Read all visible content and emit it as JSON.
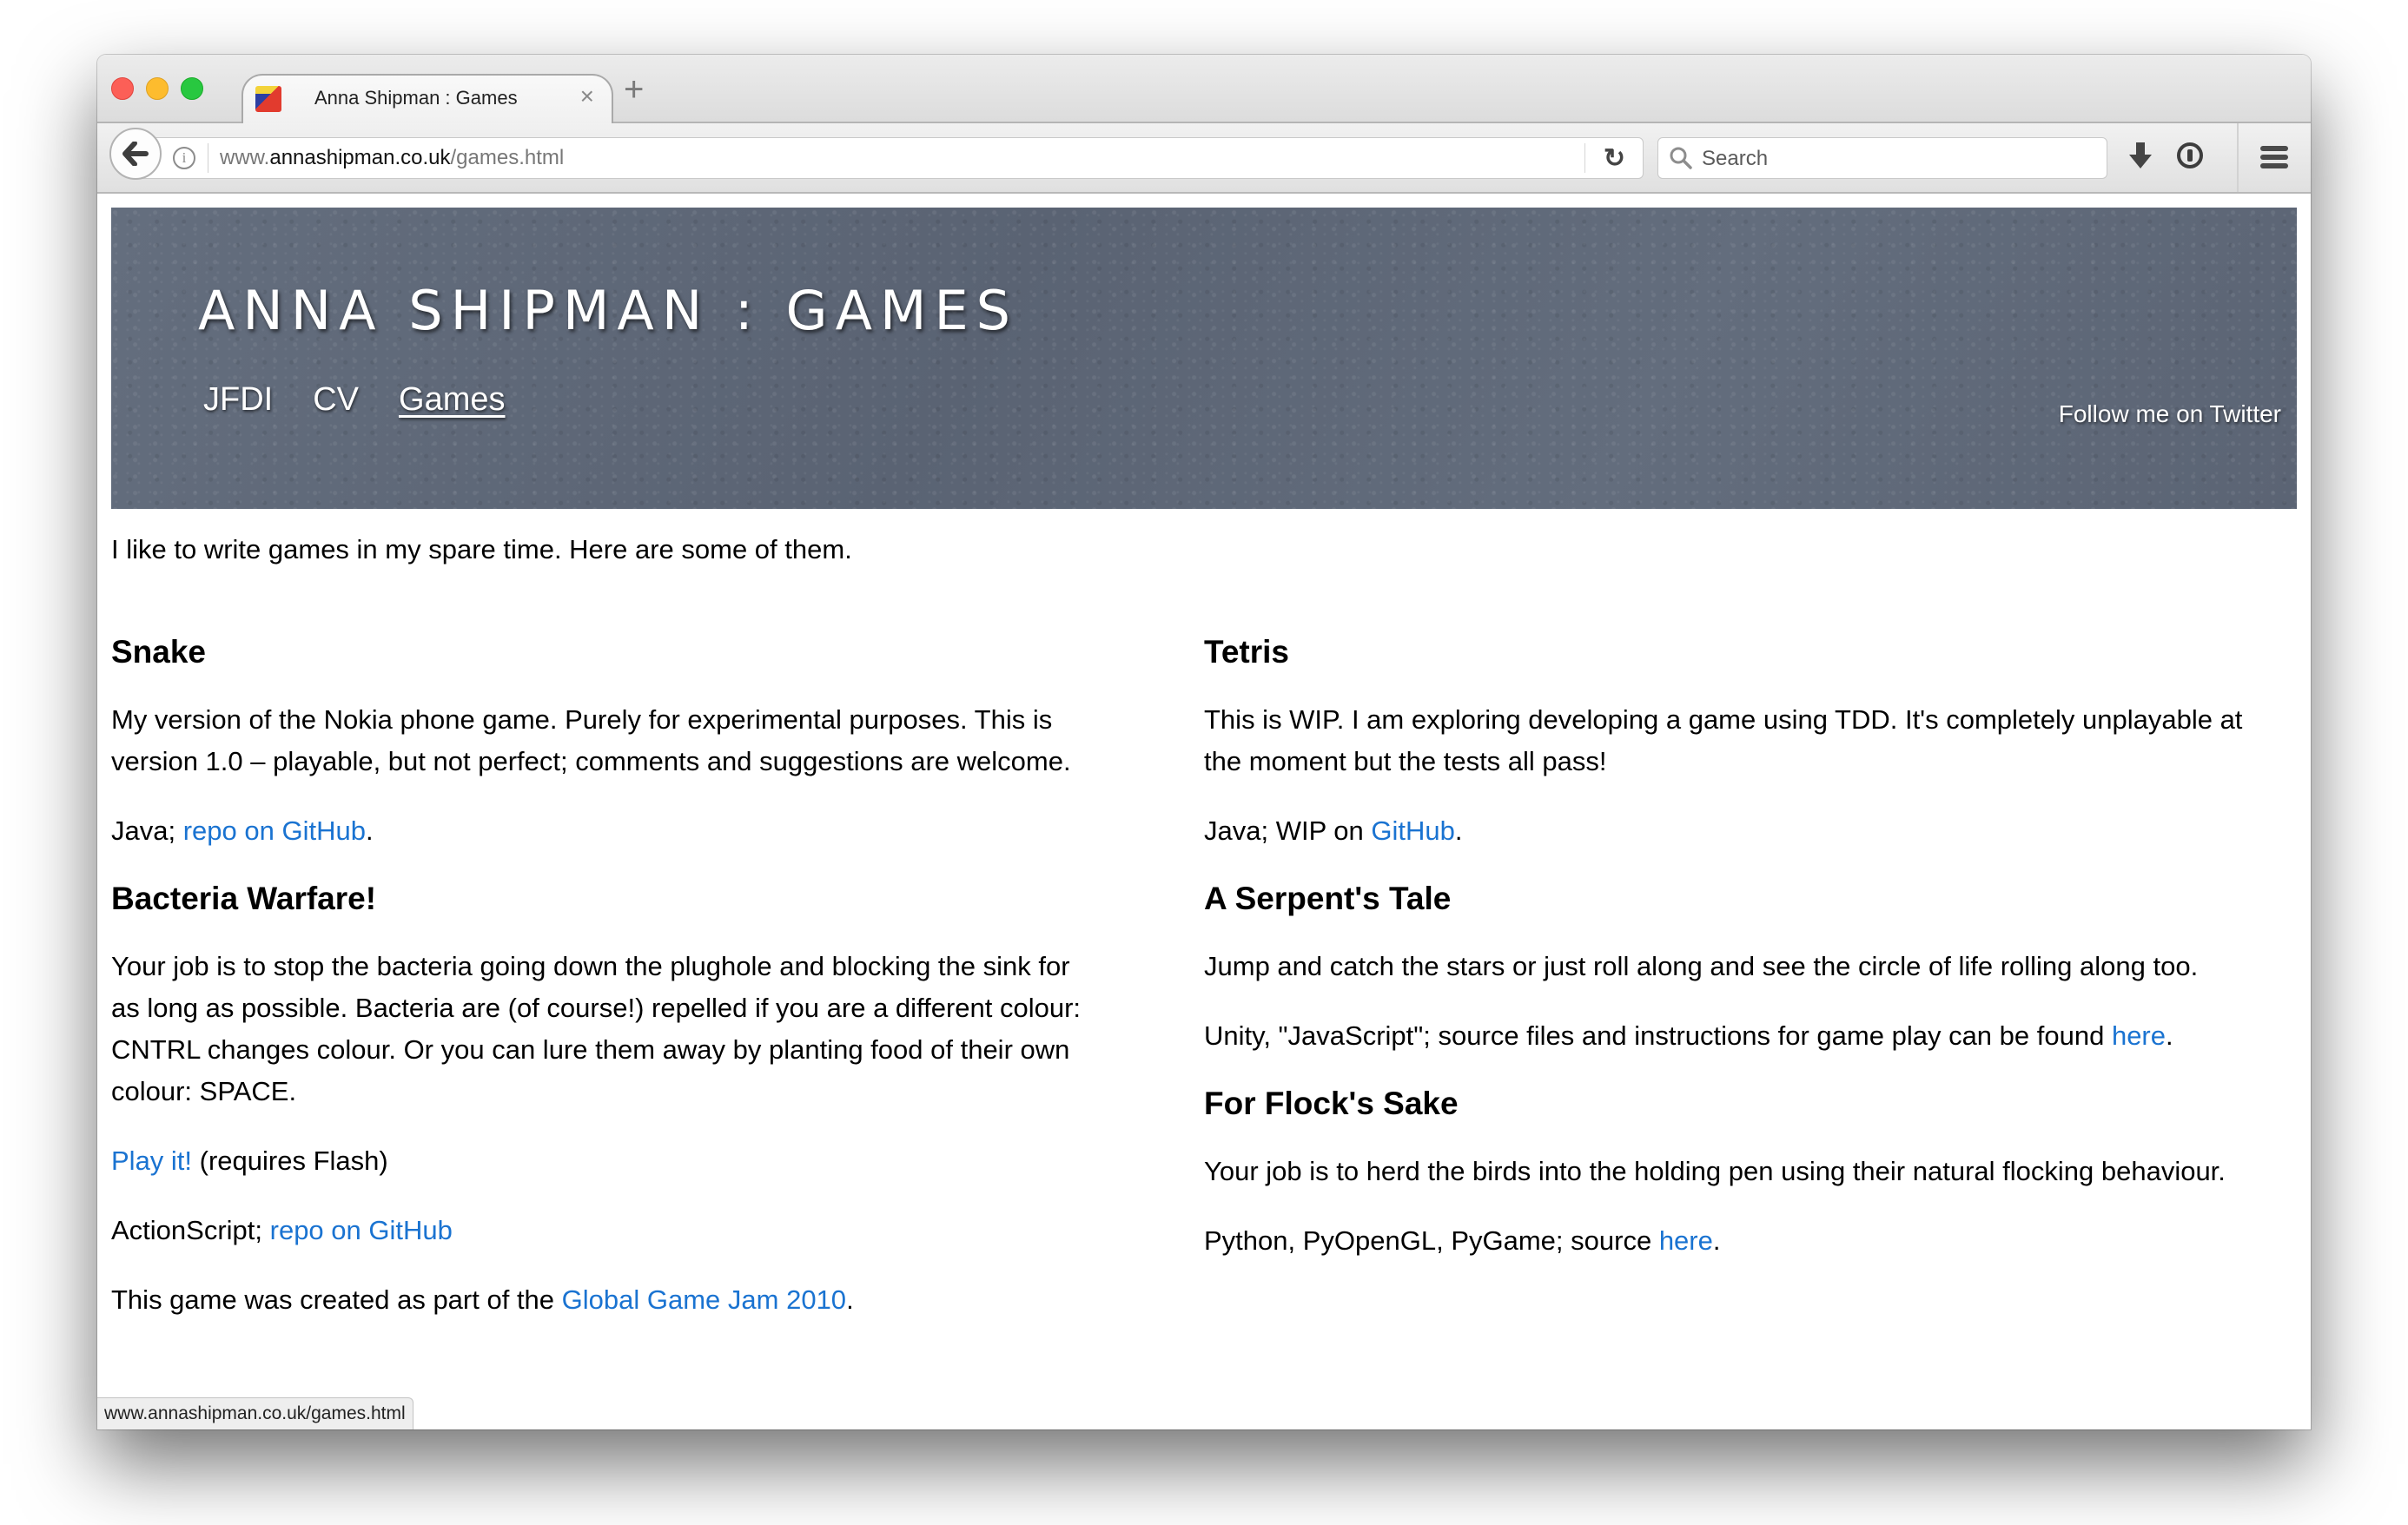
{
  "browser": {
    "tab": {
      "title": "Anna Shipman : Games",
      "favicon": "rubiks-cube-icon",
      "close_glyph": "×"
    },
    "new_tab_glyph": "+",
    "url": {
      "prefix": "www.",
      "host": "annashipman.co.uk",
      "path": "/games.html"
    },
    "search": {
      "placeholder": "Search",
      "value": ""
    },
    "icons": [
      "back-arrow-icon",
      "info-icon",
      "reload-icon",
      "search-icon",
      "download-icon",
      "password-manager-icon",
      "menu-icon"
    ],
    "status_url": "www.annashipman.co.uk/games.html"
  },
  "header": {
    "title": "ANNA SHIPMAN : GAMES",
    "nav": [
      {
        "label": "JFDI",
        "active": false
      },
      {
        "label": "CV",
        "active": false
      },
      {
        "label": "Games",
        "active": true
      }
    ],
    "twitter_link": "Follow me on Twitter",
    "background_color": "#5f6979"
  },
  "intro": "I like to write games in my spare time. Here are some of them.",
  "link_color": "#1a73d1",
  "games_left": [
    {
      "title": "Snake",
      "description": "My version of the Nokia phone game. Purely for experimental purposes. This is version 1.0 – playable, but not perfect; comments and suggestions are welcome.",
      "tech_prefix": "Java; ",
      "tech_link": "repo on GitHub",
      "tech_suffix": "."
    },
    {
      "title": "Bacteria Warfare!",
      "description": "Your job is to stop the bacteria going down the plughole and blocking the sink for as long as possible. Bacteria are (of course!) repelled if you are a different colour: CNTRL changes colour. Or you can lure them away by planting food of their own colour: SPACE.",
      "play_link": "Play it!",
      "play_suffix": " (requires Flash)",
      "tech_prefix": "ActionScript; ",
      "tech_link": "repo on GitHub",
      "tech_suffix": "",
      "credit_prefix": "This game was created as part of the ",
      "credit_link": "Global Game Jam 2010",
      "credit_suffix": "."
    }
  ],
  "games_right": [
    {
      "title": "Tetris",
      "description": "This is WIP. I am exploring developing a game using TDD. It's completely unplayable at the moment but the tests all pass!",
      "tech_prefix": "Java; WIP on ",
      "tech_link": "GitHub",
      "tech_suffix": "."
    },
    {
      "title": "A Serpent's Tale",
      "description": "Jump and catch the stars or just roll along and see the circle of life rolling along too.",
      "tech_prefix": "Unity, \"JavaScript\"; source files and instructions for game play can be found ",
      "tech_link": "here",
      "tech_suffix": "."
    },
    {
      "title": "For Flock's Sake",
      "description": "Your job is to herd the birds into the holding pen using their natural flocking behaviour.",
      "tech_prefix": "Python, PyOpenGL, PyGame; source ",
      "tech_link": "here",
      "tech_suffix": "."
    }
  ]
}
